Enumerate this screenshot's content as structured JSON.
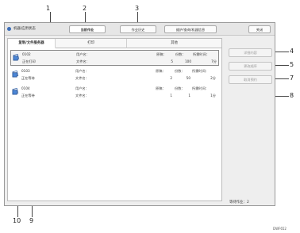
{
  "callouts": [
    "1",
    "2",
    "3",
    "4",
    "5",
    "7",
    "8",
    "10",
    "9"
  ],
  "topbar": {
    "status_label": "机器/应用状态",
    "tab_current": "当前作业",
    "tab_history": "作业历史",
    "maintenance": "维护/查询/机器信息",
    "close": "关闭"
  },
  "tabs": [
    "复制/文件服务器",
    "打印",
    "其他"
  ],
  "job_labels": {
    "user": "用户名：",
    "file": "文件名：",
    "paper": "原稿：",
    "sets": "份数：",
    "time": "所需时间："
  },
  "jobs": [
    {
      "id": "0102",
      "status": "正在打印",
      "paper": "5",
      "sets": "100",
      "time": "7分"
    },
    {
      "id": "0103",
      "status": "正在等待",
      "paper": "2",
      "sets": "50",
      "time": "2分"
    },
    {
      "id": "0104",
      "status": "正在等待",
      "paper": "1",
      "sets": "1",
      "time": "1分"
    }
  ],
  "side_buttons": {
    "details": "详细内容",
    "change_order": "更改顺序",
    "cancel_reserve": "取消预约"
  },
  "total": {
    "label": "等待作业：",
    "value": "2"
  },
  "figure_id": "DWF652"
}
